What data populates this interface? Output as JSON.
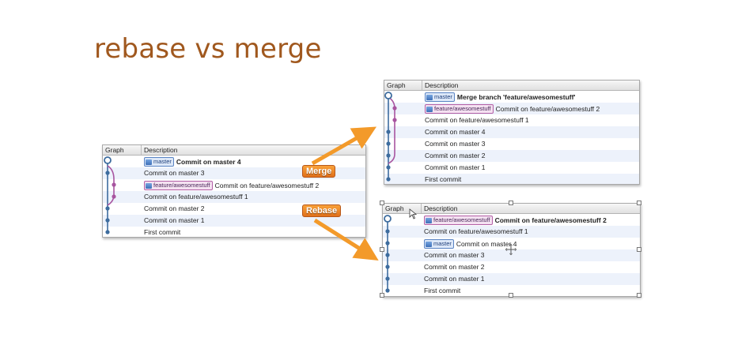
{
  "title": "rebase vs merge",
  "header": {
    "graph": "Graph",
    "description": "Description"
  },
  "labels": {
    "merge": "Merge",
    "rebase": "Rebase"
  },
  "icons": {
    "branch_tag": "branch-tag-icon",
    "cursor": "arrow-cursor-icon",
    "move": "move-cursor-icon"
  },
  "colors": {
    "title": "#a0581e",
    "arrow": "#f39a2a",
    "master_line": "#3d6c9e",
    "feature_line": "#a855a0"
  },
  "left_panel": {
    "rows": [
      {
        "badge": "master",
        "badge_type": "master",
        "message": "Commit on master 4",
        "bold": true
      },
      {
        "message": "Commit on master 3"
      },
      {
        "badge": "feature/awesomestuff",
        "badge_type": "feature",
        "message": "Commit on feature/awesomestuff 2"
      },
      {
        "message": "Commit on feature/awesomestuff 1"
      },
      {
        "message": "Commit on master 2"
      },
      {
        "message": "Commit on master 1"
      },
      {
        "message": "First commit"
      }
    ]
  },
  "merge_panel": {
    "rows": [
      {
        "badge": "master",
        "badge_type": "master",
        "message": "Merge branch 'feature/awesomestuff'",
        "bold": true
      },
      {
        "badge": "feature/awesomestuff",
        "badge_type": "feature",
        "message": "Commit on feature/awesomestuff 2"
      },
      {
        "message": "Commit on feature/awesomestuff 1"
      },
      {
        "message": "Commit on master 4"
      },
      {
        "message": "Commit on master 3"
      },
      {
        "message": "Commit on master 2"
      },
      {
        "message": "Commit on master 1"
      },
      {
        "message": "First commit"
      }
    ]
  },
  "rebase_panel": {
    "rows": [
      {
        "badge": "feature/awesomestuff",
        "badge_type": "feature",
        "message": "Commit on feature/awesomestuff 2",
        "bold": true
      },
      {
        "message": "Commit on feature/awesomestuff 1"
      },
      {
        "badge": "master",
        "badge_type": "master",
        "message": "Commit on master 4"
      },
      {
        "message": "Commit on master 3"
      },
      {
        "message": "Commit on master 2"
      },
      {
        "message": "Commit on master 1"
      },
      {
        "message": "First commit"
      }
    ]
  }
}
